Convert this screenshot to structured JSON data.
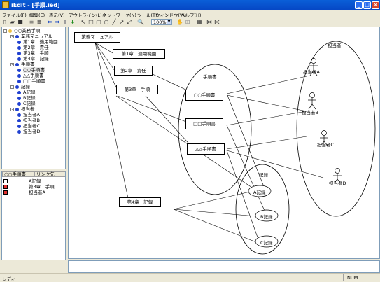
{
  "window": {
    "title": "iEdit - [手順.ied]"
  },
  "menu": [
    "ファイル(F)",
    "編集(E)",
    "表示(V)",
    "アウトライン(L)",
    "ネットワーク(N)",
    "ツール(T)",
    "ウィンドウ(W)",
    "ヘルプ(H)"
  ],
  "toolbar": {
    "zoom": "100%"
  },
  "tree": [
    {
      "label": "○○業務手順",
      "level": 0,
      "exp": "-"
    },
    {
      "label": "業務マニュアル",
      "level": 1,
      "exp": "-"
    },
    {
      "label": "第1章　適用範囲",
      "level": 2
    },
    {
      "label": "第2章　責任",
      "level": 2
    },
    {
      "label": "第3章　手順",
      "level": 2
    },
    {
      "label": "第4章　記録",
      "level": 2
    },
    {
      "label": "手順書",
      "level": 1,
      "exp": "-"
    },
    {
      "label": "○○手順書",
      "level": 2,
      "sel": true
    },
    {
      "label": "△△手順書",
      "level": 2
    },
    {
      "label": "□□手順書",
      "level": 2
    },
    {
      "label": "記録",
      "level": 1,
      "exp": "-"
    },
    {
      "label": "A記録",
      "level": 2
    },
    {
      "label": "B記録",
      "level": 2
    },
    {
      "label": "C記録",
      "level": 2
    },
    {
      "label": "担当者",
      "level": 1,
      "exp": "-"
    },
    {
      "label": "担当者A",
      "level": 2
    },
    {
      "label": "担当者B",
      "level": 2
    },
    {
      "label": "担当者C",
      "level": 2
    },
    {
      "label": "担当者D",
      "level": 2
    }
  ],
  "links": {
    "headers": [
      "○○手順書",
      "リンク先"
    ],
    "rows": [
      {
        "text": "A記録",
        "red": false
      },
      {
        "text": "第3章　手順",
        "red": true
      },
      {
        "text": "担当者A",
        "red": true
      }
    ]
  },
  "diagram": {
    "boxes": {
      "manual": "業務マニュアル",
      "ch1": "第1章　適用範囲",
      "ch2": "第2章　責任",
      "ch3": "第3章　手順",
      "ch4": "第4章　記録",
      "procA": "○○手順書",
      "procB": "□□手順書",
      "procC": "△△手順書",
      "recA": "A記録",
      "recB": "B記録",
      "recC": "C記録"
    },
    "groups": {
      "proc": "手順書",
      "rec": "記録",
      "staff": "担当者"
    },
    "actors": [
      "担当者A",
      "担当者B",
      "担当者C",
      "担当者D"
    ]
  },
  "status": {
    "text": "レディ",
    "num": "NUM"
  }
}
